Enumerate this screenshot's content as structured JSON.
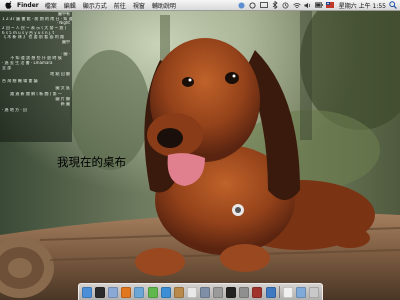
{
  "menubar": {
    "app_name": "Finder",
    "items": [
      "檔案",
      "編輯",
      "顯示方式",
      "前往",
      "視窗",
      "輔助說明"
    ],
    "clock": "星期六 上午 1:55"
  },
  "widget": {
    "lines": [
      {
        "text": "圖中有",
        "align": "right"
      },
      {
        "text": "1 2:37 圖 書 館 · 前 期 的 南 日 · 知 道",
        "align": "left"
      },
      {
        "text": "· Night",
        "align": "right"
      },
      {
        "text": "2 回 ~ 人 民 ~ 表 示 ( 大 發 ~ 放 )",
        "align": "left"
      },
      {
        "text": "6 s 5 m u s y 台 y u s n j. t",
        "align": "left"
      },
      {
        "text": "【 木 新 林 】 也 要 前 看 面 的 路",
        "align": "left"
      },
      {
        "text": "圖中",
        "align": "right"
      },
      {
        "text": "",
        "align": "left"
      },
      {
        "text": "· 圖 ·",
        "align": "right"
      },
      {
        "text": "不 知 道 該 想 些 什 麼 時 候",
        "align": "center"
      },
      {
        "text": "· 過 去 生 活 書 · Lmamara",
        "align": "left"
      },
      {
        "text": "全 部",
        "align": "left"
      },
      {
        "text": "地 點 回 顧",
        "align": "right"
      },
      {
        "text": "台 灣 總 機 場 會 議",
        "align": "left"
      },
      {
        "text": "圖 文 區",
        "align": "right"
      },
      {
        "text": "路 過 新 聞 網 ( 新 聞 ) 第 一",
        "align": "center"
      },
      {
        "text": "圖 片 顯",
        "align": "right"
      },
      {
        "text": "新 圖",
        "align": "right"
      },
      {
        "text": "· 過 地 方 · 回",
        "align": "left"
      }
    ]
  },
  "desktop": {
    "caption": "我現在的桌布"
  },
  "dock": {
    "icons": [
      {
        "name": "finder-icon",
        "color": "#4a8fd8"
      },
      {
        "name": "dashboard-icon",
        "color": "#2b2b2b"
      },
      {
        "name": "mail-icon",
        "color": "#8ba9d6"
      },
      {
        "name": "firefox-icon",
        "color": "#e0761e"
      },
      {
        "name": "itunes-icon",
        "color": "#6aa7d8"
      },
      {
        "name": "ichat-icon",
        "color": "#5fb84b"
      },
      {
        "name": "safari-icon",
        "color": "#3c8fd6"
      },
      {
        "name": "address-book-icon",
        "color": "#b98a4a"
      },
      {
        "name": "ical-icon",
        "color": "#e8e8e8"
      },
      {
        "name": "iphoto-icon",
        "color": "#7f8fa8"
      },
      {
        "name": "preview-icon",
        "color": "#9a9a9a"
      },
      {
        "name": "terminal-icon",
        "color": "#222222"
      },
      {
        "name": "system-preferences-icon",
        "color": "#8f8f8f"
      },
      {
        "name": "photo-booth-icon",
        "color": "#a0342d"
      },
      {
        "name": "quicktime-icon",
        "color": "#3f79c2"
      },
      {
        "name": "textedit-icon",
        "color": "#f0f0f0"
      },
      {
        "name": "folder-icon",
        "color": "#7fa9d9"
      },
      {
        "name": "trash-icon",
        "color": "#c9c9c9"
      }
    ]
  }
}
